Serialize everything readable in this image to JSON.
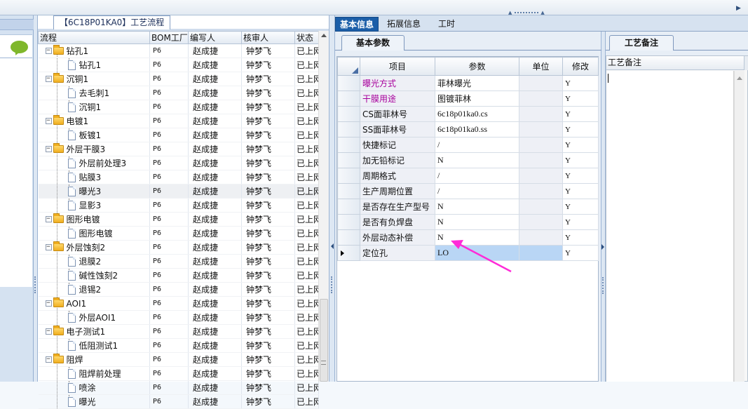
{
  "colors": {
    "annotation_arrow": "#ff2bd8",
    "active_tab": "#1b5ea8",
    "highlight_label": "#a8009c"
  },
  "tree_panel": {
    "tab_label": "【6C18P01KA0】工艺流程",
    "columns": [
      "流程",
      "BOM工厂",
      "编写人",
      "核审人",
      "状态"
    ],
    "rows": [
      {
        "name": "钻孔1",
        "level": 0,
        "type": "folder",
        "expander": "minus",
        "bom": "P6",
        "writer": "赵成捷",
        "reviewer": "钟梦飞",
        "status": "已上网"
      },
      {
        "name": "钻孔1",
        "level": 1,
        "type": "doc",
        "bom": "P6",
        "writer": "赵成捷",
        "reviewer": "钟梦飞",
        "status": "已上网"
      },
      {
        "name": "沉铜1",
        "level": 0,
        "type": "folder",
        "expander": "minus",
        "bom": "P6",
        "writer": "赵成捷",
        "reviewer": "钟梦飞",
        "status": "已上网"
      },
      {
        "name": "去毛刺1",
        "level": 1,
        "type": "doc",
        "bom": "P6",
        "writer": "赵成捷",
        "reviewer": "钟梦飞",
        "status": "已上网"
      },
      {
        "name": "沉铜1",
        "level": 1,
        "type": "doc",
        "bom": "P6",
        "writer": "赵成捷",
        "reviewer": "钟梦飞",
        "status": "已上网"
      },
      {
        "name": "电镀1",
        "level": 0,
        "type": "folder",
        "expander": "minus",
        "bom": "P6",
        "writer": "赵成捷",
        "reviewer": "钟梦飞",
        "status": "已上网"
      },
      {
        "name": "板镀1",
        "level": 1,
        "type": "doc",
        "bom": "P6",
        "writer": "赵成捷",
        "reviewer": "钟梦飞",
        "status": "已上网"
      },
      {
        "name": "外层干膜3",
        "level": 0,
        "type": "folder",
        "expander": "minus",
        "bom": "P6",
        "writer": "赵成捷",
        "reviewer": "钟梦飞",
        "status": "已上网"
      },
      {
        "name": "外层前处理3",
        "level": 1,
        "type": "doc",
        "bom": "P6",
        "writer": "赵成捷",
        "reviewer": "钟梦飞",
        "status": "已上网"
      },
      {
        "name": "贴膜3",
        "level": 1,
        "type": "doc",
        "bom": "P6",
        "writer": "赵成捷",
        "reviewer": "钟梦飞",
        "status": "已上网"
      },
      {
        "name": "曝光3",
        "level": 1,
        "type": "doc",
        "bom": "P6",
        "writer": "赵成捷",
        "reviewer": "钟梦飞",
        "status": "已上网",
        "selected": true
      },
      {
        "name": "显影3",
        "level": 1,
        "type": "doc",
        "bom": "P6",
        "writer": "赵成捷",
        "reviewer": "钟梦飞",
        "status": "已上网"
      },
      {
        "name": "图形电镀",
        "level": 0,
        "type": "folder",
        "expander": "minus",
        "bom": "P6",
        "writer": "赵成捷",
        "reviewer": "钟梦飞",
        "status": "已上网"
      },
      {
        "name": "图形电镀",
        "level": 1,
        "type": "doc",
        "bom": "P6",
        "writer": "赵成捷",
        "reviewer": "钟梦飞",
        "status": "已上网"
      },
      {
        "name": "外层蚀刻2",
        "level": 0,
        "type": "folder",
        "expander": "minus",
        "bom": "P6",
        "writer": "赵成捷",
        "reviewer": "钟梦飞",
        "status": "已上网"
      },
      {
        "name": "退膜2",
        "level": 1,
        "type": "doc",
        "bom": "P6",
        "writer": "赵成捷",
        "reviewer": "钟梦飞",
        "status": "已上网"
      },
      {
        "name": "碱性蚀刻2",
        "level": 1,
        "type": "doc",
        "bom": "P6",
        "writer": "赵成捷",
        "reviewer": "钟梦飞",
        "status": "已上网"
      },
      {
        "name": "退锡2",
        "level": 1,
        "type": "doc",
        "bom": "P6",
        "writer": "赵成捷",
        "reviewer": "钟梦飞",
        "status": "已上网"
      },
      {
        "name": "AOI1",
        "level": 0,
        "type": "folder",
        "expander": "minus",
        "bom": "P6",
        "writer": "赵成捷",
        "reviewer": "钟梦飞",
        "status": "已上网"
      },
      {
        "name": "外层AOI1",
        "level": 1,
        "type": "doc",
        "bom": "P6",
        "writer": "赵成捷",
        "reviewer": "钟梦飞",
        "status": "已上网"
      },
      {
        "name": "电子测试1",
        "level": 0,
        "type": "folder",
        "expander": "minus",
        "bom": "P6",
        "writer": "赵成捷",
        "reviewer": "钟梦飞",
        "status": "已上网"
      },
      {
        "name": "低阻测试1",
        "level": 1,
        "type": "doc",
        "bom": "P6",
        "writer": "赵成捷",
        "reviewer": "钟梦飞",
        "status": "已上网"
      },
      {
        "name": "阻焊",
        "level": 0,
        "type": "folder",
        "expander": "minus",
        "bom": "P6",
        "writer": "赵成捷",
        "reviewer": "钟梦飞",
        "status": "已上网"
      },
      {
        "name": "阻焊前处理",
        "level": 1,
        "type": "doc",
        "bom": "P6",
        "writer": "赵成捷",
        "reviewer": "钟梦飞",
        "status": "已上网"
      },
      {
        "name": "喷涂",
        "level": 1,
        "type": "doc",
        "bom": "P6",
        "writer": "赵成捷",
        "reviewer": "钟梦飞",
        "status": "已上网"
      },
      {
        "name": "曝光",
        "level": 1,
        "type": "doc",
        "bom": "P6",
        "writer": "赵成捷",
        "reviewer": "钟梦飞",
        "status": "已上网"
      }
    ]
  },
  "main_tabs": [
    {
      "label": "基本信息",
      "active": true
    },
    {
      "label": "拓展信息",
      "active": false
    },
    {
      "label": "工时",
      "active": false
    }
  ],
  "param_panel": {
    "subtab_label": "基本参数",
    "columns": [
      "项目",
      "参数",
      "单位",
      "修改"
    ],
    "rows": [
      {
        "item": "曝光方式",
        "value": "菲林曝光",
        "unit": "",
        "modify": "Y",
        "highlight": true
      },
      {
        "item": "干膜用途",
        "value": "图镀菲林",
        "unit": "",
        "modify": "Y",
        "highlight": true
      },
      {
        "item": "CS面菲林号",
        "value": "6c18p01ka0.cs",
        "unit": "",
        "modify": "Y"
      },
      {
        "item": "SS面菲林号",
        "value": "6c18p01ka0.ss",
        "unit": "",
        "modify": "Y"
      },
      {
        "item": "快捷标记",
        "value": "/",
        "unit": "",
        "modify": "Y"
      },
      {
        "item": "加无铅标记",
        "value": "N",
        "unit": "",
        "modify": "Y"
      },
      {
        "item": "周期格式",
        "value": "/",
        "unit": "",
        "modify": "Y"
      },
      {
        "item": "生产周期位置",
        "value": "/",
        "unit": "",
        "modify": "Y"
      },
      {
        "item": "是否存在生产型号",
        "value": "N",
        "unit": "",
        "modify": "Y"
      },
      {
        "item": "是否有负焊盘",
        "value": "N",
        "unit": "",
        "modify": "Y"
      },
      {
        "item": "外层动态补偿",
        "value": "N",
        "unit": "",
        "modify": "Y"
      },
      {
        "item": "定位孔",
        "value": "LO",
        "unit": "",
        "modify": "Y",
        "current": true
      }
    ]
  },
  "notes_panel": {
    "tab_label": "工艺备注",
    "column_header": "工艺备注"
  }
}
